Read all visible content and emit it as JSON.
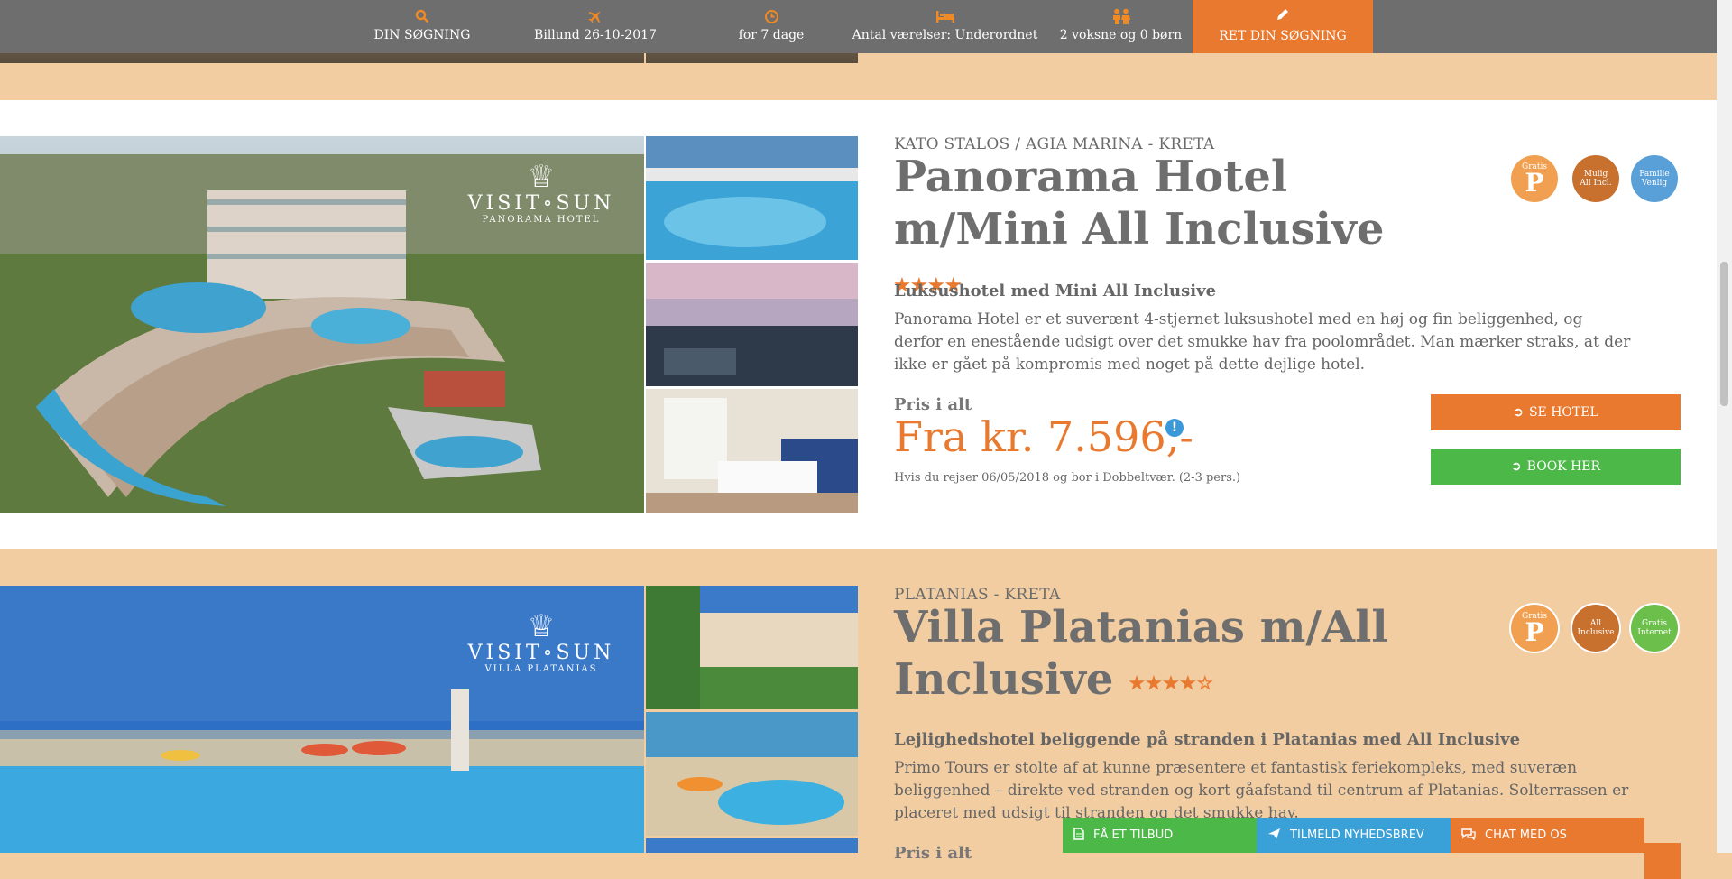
{
  "search_bar": {
    "items": [
      {
        "icon": "search-icon",
        "label": "DIN SØGNING"
      },
      {
        "icon": "plane-icon",
        "label": "Billund 26-10-2017"
      },
      {
        "icon": "clock-icon",
        "label": "for 7 dage"
      },
      {
        "icon": "bed-icon",
        "label": "Antal værelser: Underordnet"
      },
      {
        "icon": "people-icon",
        "label": "2 voksne og 0 børn"
      }
    ],
    "edit_button": {
      "icon": "pencil-icon",
      "label": "RET DIN SØGNING"
    }
  },
  "hotels": [
    {
      "location": "KATO STALOS / AGIA MARINA - KRETA",
      "title": "Panorama Hotel m/Mini All Inclusive",
      "stars": "★★★★",
      "brand": {
        "name": "VISIT∘SUN",
        "hotel": "PANORAMA HOTEL"
      },
      "subtitle": "Luksushotel med Mini All Inclusive",
      "description": "Panorama Hotel er et suverænt 4-stjernet luksushotel med en høj og fin beliggenhed, og derfor en enestående udsigt over det smukke hav fra poolområdet. Man mærker straks, at der ikke er gået på kompromis med noget på dette dejlige hotel.",
      "price_label": "Pris i alt",
      "price": "Fra kr. 7.596,-",
      "price_note": "Hvis du rejser 06/05/2018 og bor i Dobbeltvær. (2-3 pers.)",
      "info_icon": "!",
      "see_hotel": "SE HOTEL",
      "book": "BOOK HER",
      "badges": [
        {
          "top": "Gratis",
          "main": "P"
        },
        {
          "top": "Mulig",
          "main": "All Incl."
        },
        {
          "top": "Familie",
          "main": "Venlig"
        }
      ]
    },
    {
      "location": "PLATANIAS - KRETA",
      "title": "Villa Platanias m/All Inclusive",
      "stars": "★★★★☆",
      "brand": {
        "name": "VISIT∘SUN",
        "hotel": "VILLA PLATANIAS"
      },
      "subtitle": "Lejlighedshotel beliggende på stranden i Platanias med All Inclusive",
      "description": "Primo Tours er stolte af at kunne præsentere et fantastisk feriekompleks, med suveræn beliggenhed – direkte ved stranden og kort gåafstand til centrum af Platanias. Solterrassen er placeret med udsigt til stranden og det smukke hav.",
      "price_label": "Pris i alt",
      "badges": [
        {
          "top": "Gratis",
          "main": "P"
        },
        {
          "top": "All",
          "main": "Inclusive"
        },
        {
          "top": "Gratis",
          "main": "Internet"
        }
      ]
    }
  ],
  "floating_bar": {
    "offer": "FÅ ET TILBUD",
    "newsletter": "TILMELD NYHEDSBREV",
    "chat": "CHAT MED OS"
  },
  "colors": {
    "accent": "#e8792e",
    "green": "#4cb848",
    "blue": "#3aa0d8",
    "bar": "#6e6e6e",
    "bg": "#f2cda2"
  }
}
